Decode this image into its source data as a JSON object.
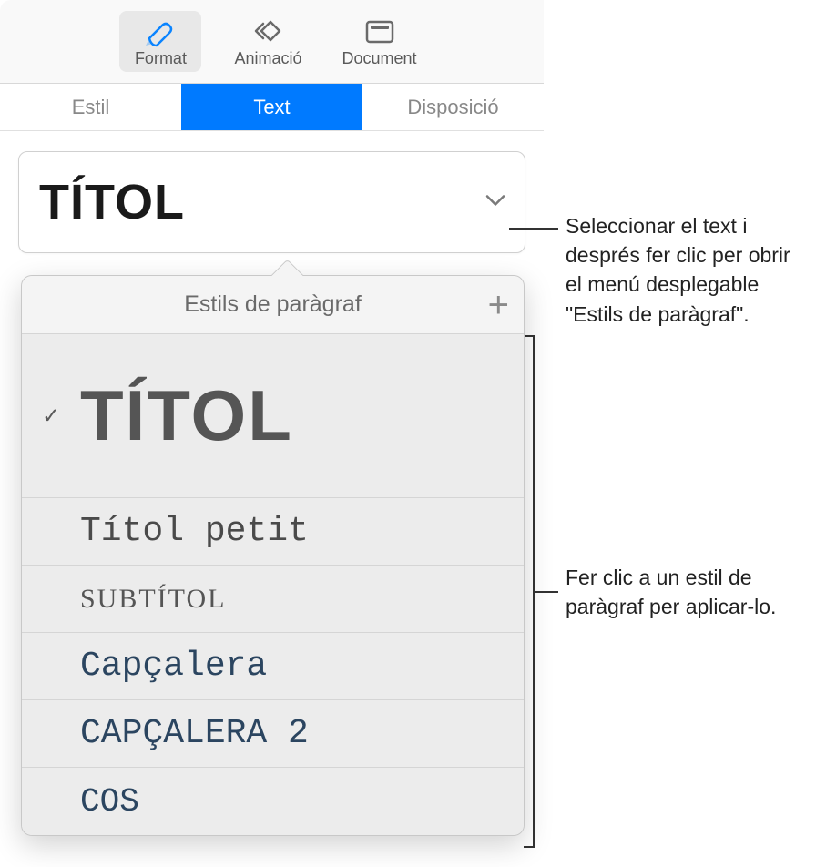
{
  "toolbar": {
    "format_label": "Format",
    "animation_label": "Animació",
    "document_label": "Document"
  },
  "tabs": {
    "style_label": "Estil",
    "text_label": "Text",
    "layout_label": "Disposició"
  },
  "style_selector": {
    "current_style": "TÍTOL"
  },
  "popover": {
    "title": "Estils de paràgraf",
    "styles": [
      {
        "label": "TÍTOL",
        "selected": true
      },
      {
        "label": "Títol petit",
        "selected": false
      },
      {
        "label": "SUBTÍTOL",
        "selected": false
      },
      {
        "label": "Capçalera",
        "selected": false
      },
      {
        "label": "CAPÇALERA 2",
        "selected": false
      },
      {
        "label": "COS",
        "selected": false
      }
    ]
  },
  "callouts": {
    "dropdown_hint": "Seleccionar el text i després fer clic per obrir el menú desplegable \"Estils de paràgraf\".",
    "apply_hint": "Fer clic a un estil de paràgraf per aplicar-lo."
  }
}
